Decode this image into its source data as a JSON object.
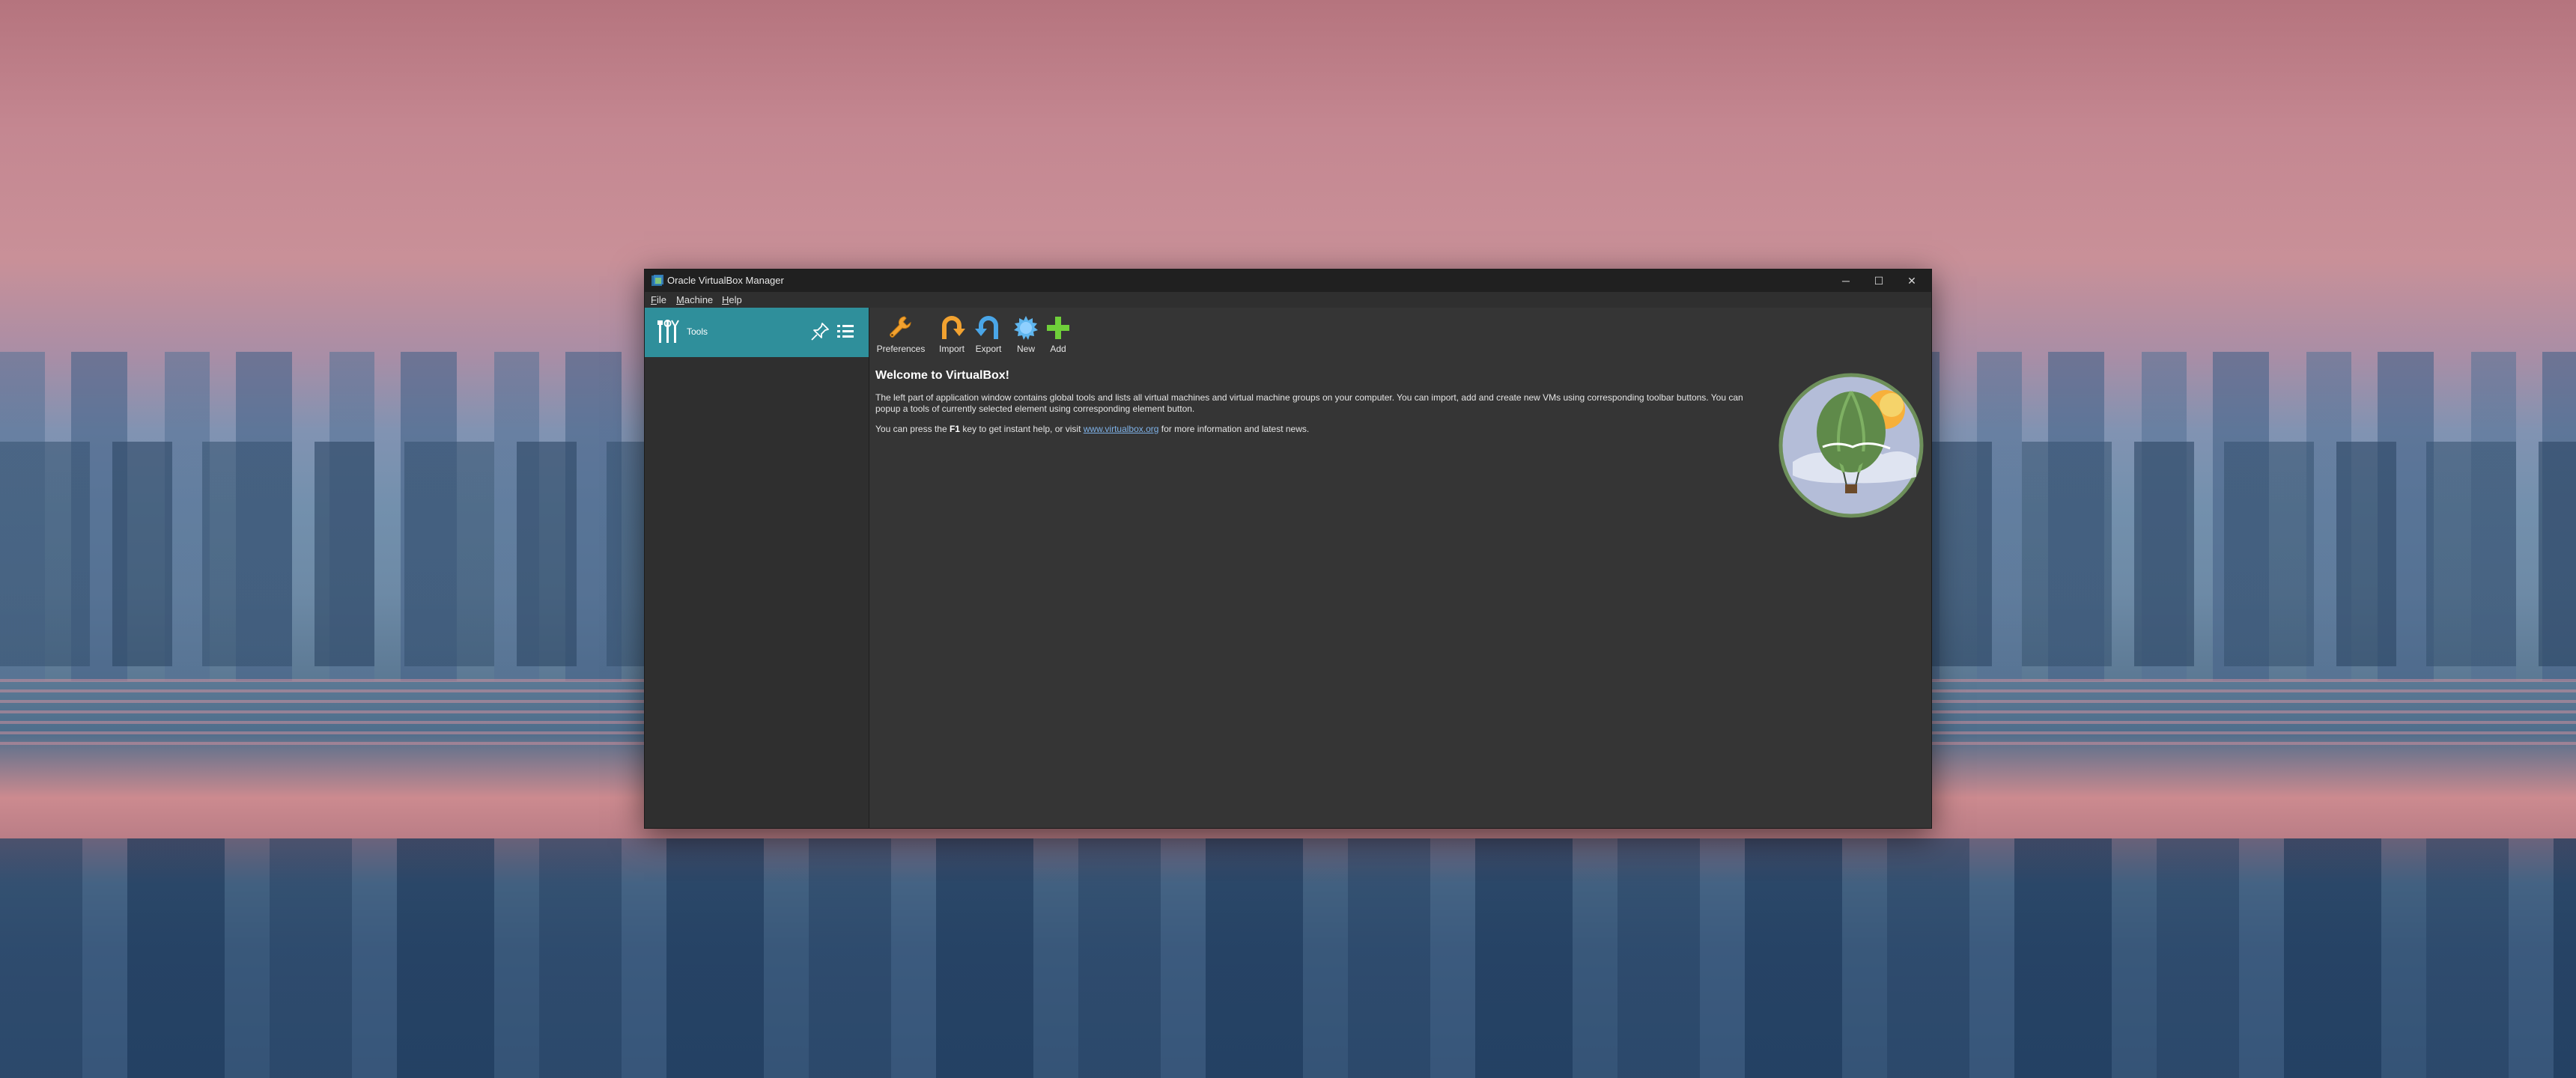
{
  "window": {
    "title": "Oracle VirtualBox Manager",
    "controls": {
      "minimize": "─",
      "maximize": "☐",
      "close": "✕"
    }
  },
  "menubar": {
    "items": [
      {
        "label_underlined": "F",
        "label_rest": "ile"
      },
      {
        "label_underlined": "M",
        "label_rest": "achine"
      },
      {
        "label_underlined": "H",
        "label_rest": "elp"
      }
    ]
  },
  "sidebar": {
    "tools_label": "Tools",
    "accent_color": "#2f8f9b"
  },
  "toolbar": {
    "preferences": "Preferences",
    "import": "Import",
    "export": "Export",
    "new": "New",
    "add": "Add"
  },
  "welcome": {
    "title": "Welcome to VirtualBox!",
    "para1": "The left part of application window contains global tools and lists all virtual machines and virtual machine groups on your computer. You can import, add and create new VMs using corresponding toolbar buttons. You can popup a tools of currently selected element using corresponding element button.",
    "para2_pre": "You can press the ",
    "para2_key": "F1",
    "para2_mid": " key to get instant help, or visit ",
    "para2_link": "www.virtualbox.org",
    "para2_post": " for more information and latest news."
  },
  "icons": {
    "app": "virtualbox-app-icon",
    "tools": "tools-icon",
    "pin": "pin-icon",
    "list": "list-menu-icon",
    "preferences": "wrench-icon",
    "import": "import-arrow-icon",
    "export": "export-arrow-icon",
    "new": "new-gear-icon",
    "add": "add-plus-icon",
    "logo": "virtualbox-balloon-logo"
  }
}
